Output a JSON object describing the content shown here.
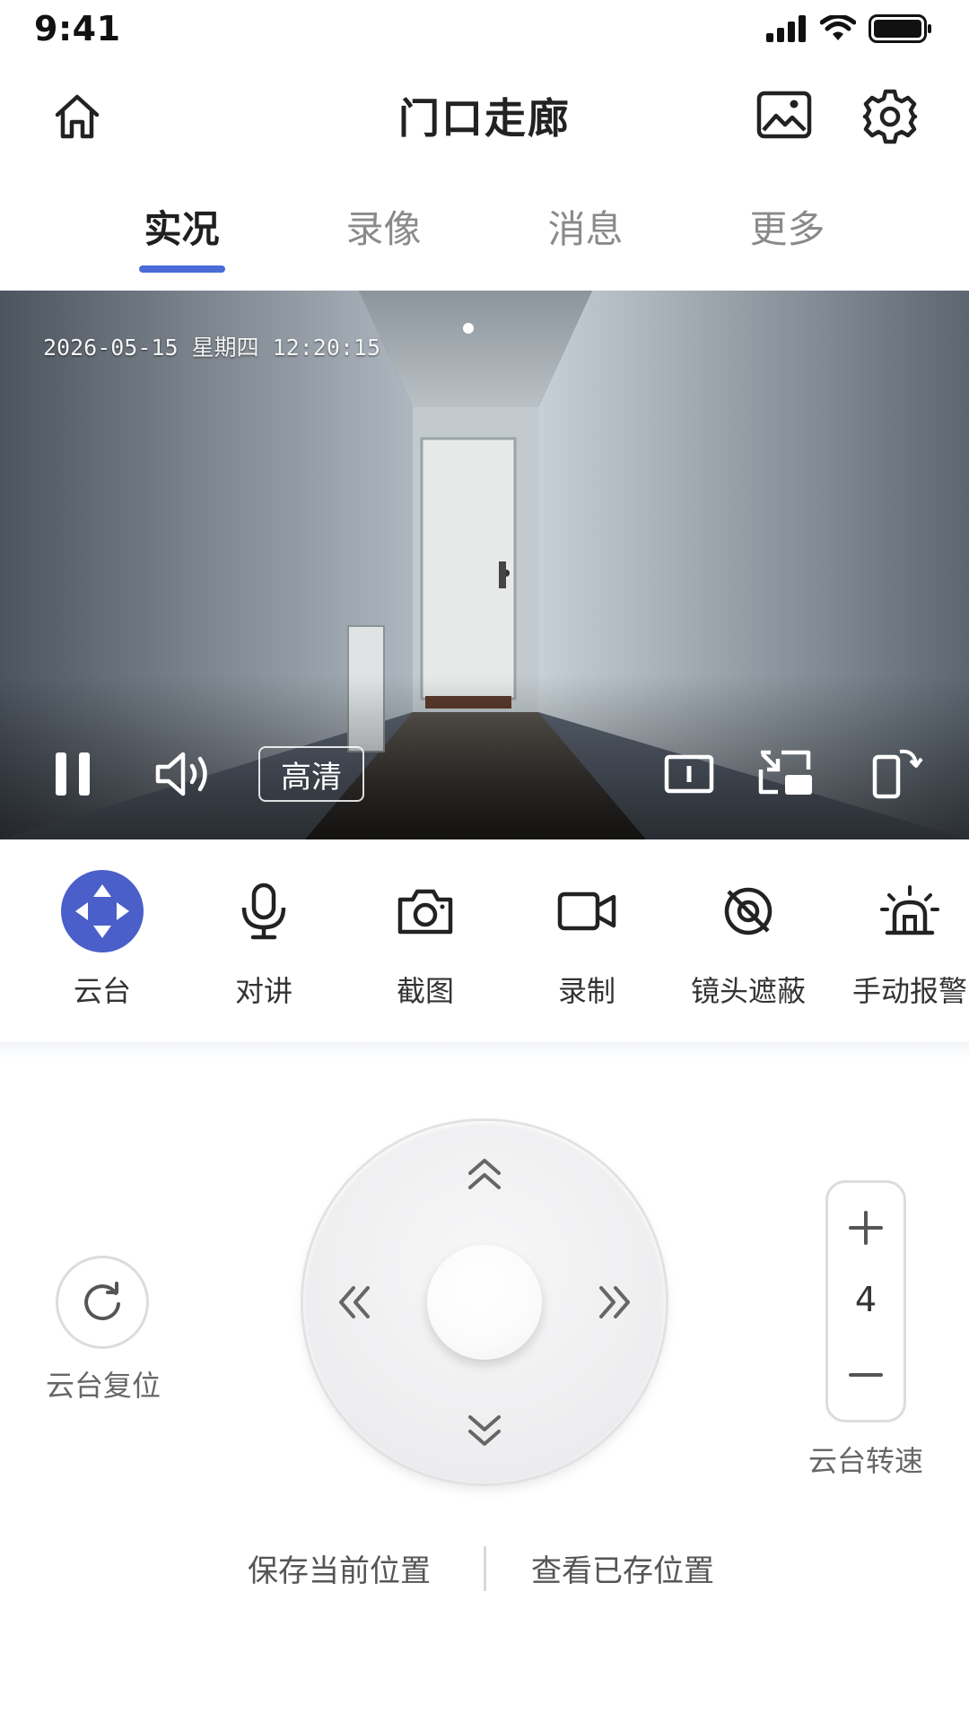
{
  "status_bar": {
    "time": "9:41",
    "icons": [
      "signal-icon",
      "wifi-icon",
      "battery-icon"
    ]
  },
  "header": {
    "title": "门口走廊",
    "left_icon": "home-icon",
    "right_icons": [
      "gallery-icon",
      "settings-icon"
    ]
  },
  "tabs": [
    {
      "label": "实况",
      "active": true
    },
    {
      "label": "录像",
      "active": false
    },
    {
      "label": "消息",
      "active": false
    },
    {
      "label": "更多",
      "active": false
    }
  ],
  "video": {
    "timestamp": "2026-05-15 星期四 12:20:15",
    "quality_label": "高清",
    "controls": [
      "pause-icon",
      "volume-icon",
      "info-icon",
      "picture-in-picture-icon",
      "rotate-screen-icon"
    ]
  },
  "tools": [
    {
      "label": "云台",
      "icon": "ptz-move-icon",
      "active": true
    },
    {
      "label": "对讲",
      "icon": "microphone-icon",
      "active": false
    },
    {
      "label": "截图",
      "icon": "camera-icon",
      "active": false
    },
    {
      "label": "录制",
      "icon": "video-record-icon",
      "active": false
    },
    {
      "label": "镜头遮蔽",
      "icon": "lens-privacy-icon",
      "active": false
    },
    {
      "label": "手动报警",
      "icon": "alarm-siren-icon",
      "active": false
    }
  ],
  "ptz": {
    "reset_label": "云台复位",
    "speed_label": "云台转速",
    "speed_value": "4",
    "save_position": "保存当前位置",
    "view_positions": "查看已存位置"
  },
  "colors": {
    "accent": "#4a6bd8",
    "ptz_active": "#4a5fc9"
  }
}
